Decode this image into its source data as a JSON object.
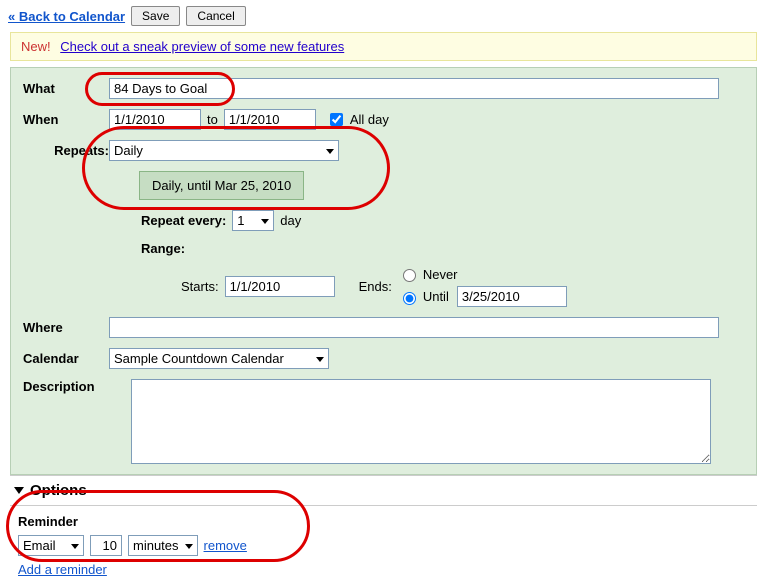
{
  "top": {
    "back_link": "« Back to Calendar",
    "save_label": "Save",
    "cancel_label": "Cancel"
  },
  "notice": {
    "new_label": "New!",
    "preview_link": "Check out a sneak preview of some new features"
  },
  "what": {
    "label": "What",
    "value": "84 Days to Goal"
  },
  "when": {
    "label": "When",
    "start": "1/1/2010",
    "to": "to",
    "end": "1/1/2010",
    "allday_label": "All day",
    "allday_checked": true
  },
  "repeats": {
    "label": "Repeats:",
    "value": "Daily",
    "summary": "Daily, until Mar 25, 2010",
    "every_label": "Repeat every:",
    "every_value": "1",
    "every_unit": "day",
    "range_label": "Range:",
    "starts_label": "Starts:",
    "starts_value": "1/1/2010",
    "ends_label": "Ends:",
    "never_label": "Never",
    "until_label": "Until",
    "until_value": "3/25/2010",
    "ends_selected": "until"
  },
  "where": {
    "label": "Where",
    "value": ""
  },
  "calendar": {
    "label": "Calendar",
    "value": "Sample Countdown Calendar"
  },
  "description": {
    "label": "Description",
    "value": ""
  },
  "options": {
    "header": "Options"
  },
  "reminder": {
    "label": "Reminder",
    "method": "Email",
    "amount": "10",
    "unit": "minutes",
    "remove": "remove",
    "add_link": "Add a reminder"
  }
}
